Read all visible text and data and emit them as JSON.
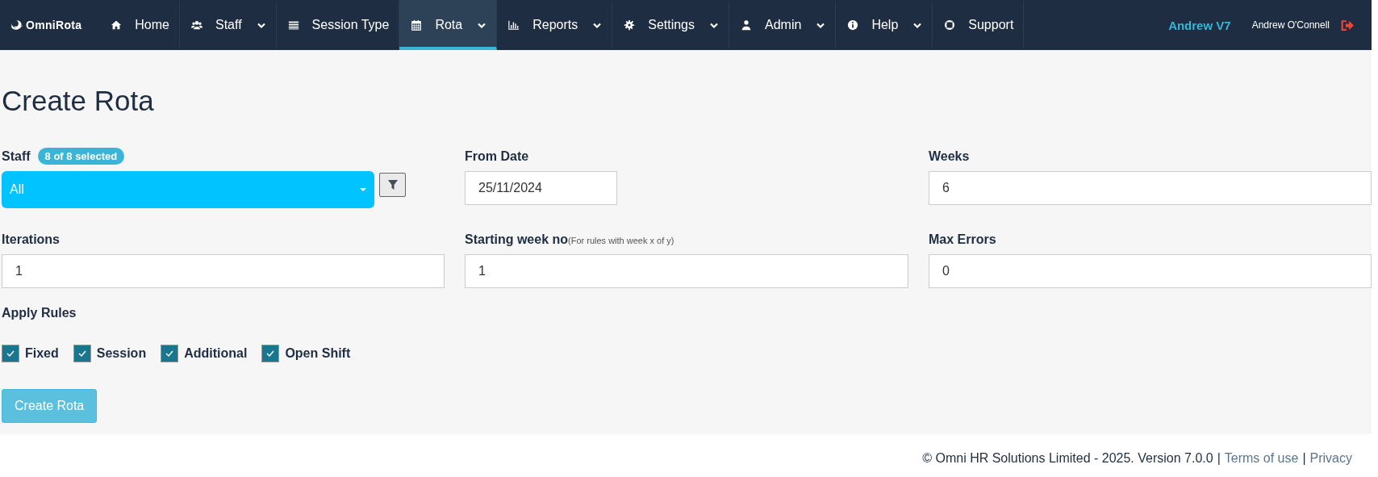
{
  "logo": {
    "text": "OmniRota"
  },
  "nav": [
    {
      "label": "Home",
      "kind": "home",
      "dropdown": false,
      "selected": false
    },
    {
      "label": "Staff",
      "kind": "users",
      "dropdown": true,
      "selected": false
    },
    {
      "label": "Session Type",
      "kind": "list",
      "dropdown": false,
      "selected": false
    },
    {
      "label": "Rota",
      "kind": "calendar",
      "dropdown": true,
      "selected": true
    },
    {
      "label": "Reports",
      "kind": "chart",
      "dropdown": true,
      "selected": false
    },
    {
      "label": "Settings",
      "kind": "gear",
      "dropdown": true,
      "selected": false
    },
    {
      "label": "Admin",
      "kind": "user",
      "dropdown": true,
      "selected": false
    },
    {
      "label": "Help",
      "kind": "info",
      "dropdown": true,
      "selected": false
    },
    {
      "label": "Support",
      "kind": "lifebuoy",
      "dropdown": false,
      "selected": false
    }
  ],
  "user": {
    "account": "Andrew V7",
    "name": "Andrew O'Connell"
  },
  "page_title": "Create Rota",
  "form": {
    "staff": {
      "label": "Staff",
      "badge": "8 of 8 selected",
      "value": "All"
    },
    "fields": [
      {
        "label": "From Date",
        "value": "25/11/2024",
        "kind": "short"
      },
      {
        "label": "Weeks",
        "value": "6",
        "kind": "wide"
      },
      {
        "label": "Iterations",
        "value": "1",
        "kind": "wide"
      },
      {
        "label": "Starting week no",
        "hint": "(For rules with week x of y)",
        "value": "1",
        "kind": "wide"
      },
      {
        "label": "Max Errors",
        "value": "0",
        "kind": "wide"
      }
    ],
    "apply_rules": {
      "label": "Apply Rules",
      "options": [
        {
          "label": "Fixed",
          "checked": true
        },
        {
          "label": "Session",
          "checked": true
        },
        {
          "label": "Additional",
          "checked": true
        },
        {
          "label": "Open Shift",
          "checked": true
        }
      ]
    },
    "submit": "Create Rota"
  },
  "footer": {
    "copyright": "© Omni HR Solutions Limited - 2025. Version 7.0.0",
    "separator_1": "|",
    "terms_link": "Terms of use",
    "separator_2": "|",
    "privacy_link": "Privacy"
  }
}
